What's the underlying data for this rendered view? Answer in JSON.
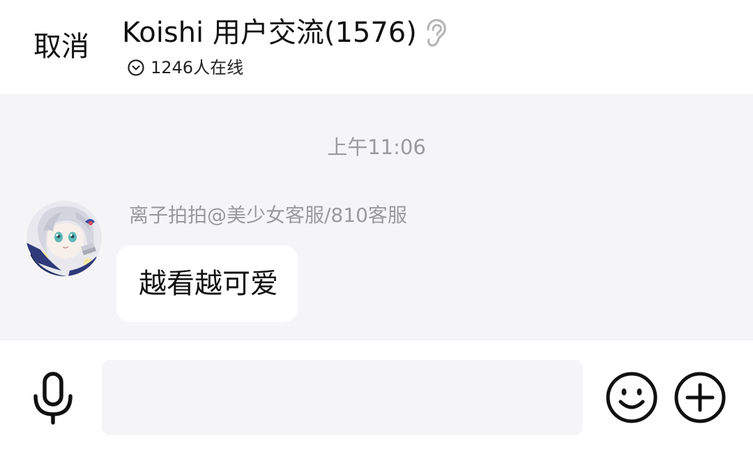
{
  "header": {
    "cancel_label": "取消",
    "title": "Koishi 用户交流(1576)",
    "online_text": "1246人在线",
    "icons": {
      "ear": "ear-icon",
      "online": "chevron-down-circle-icon"
    }
  },
  "chat": {
    "background_color": "#f5f5f7",
    "timestamp": "上午11:06",
    "messages": [
      {
        "sender": "离子拍拍@美少女客服/810客服",
        "text": "越看越可爱",
        "avatar_icon": "anime-girl-avatar"
      }
    ]
  },
  "input_bar": {
    "placeholder": "",
    "value": "",
    "icons": {
      "voice": "microphone-icon",
      "emoji": "smiley-icon",
      "more": "plus-circle-icon"
    }
  }
}
